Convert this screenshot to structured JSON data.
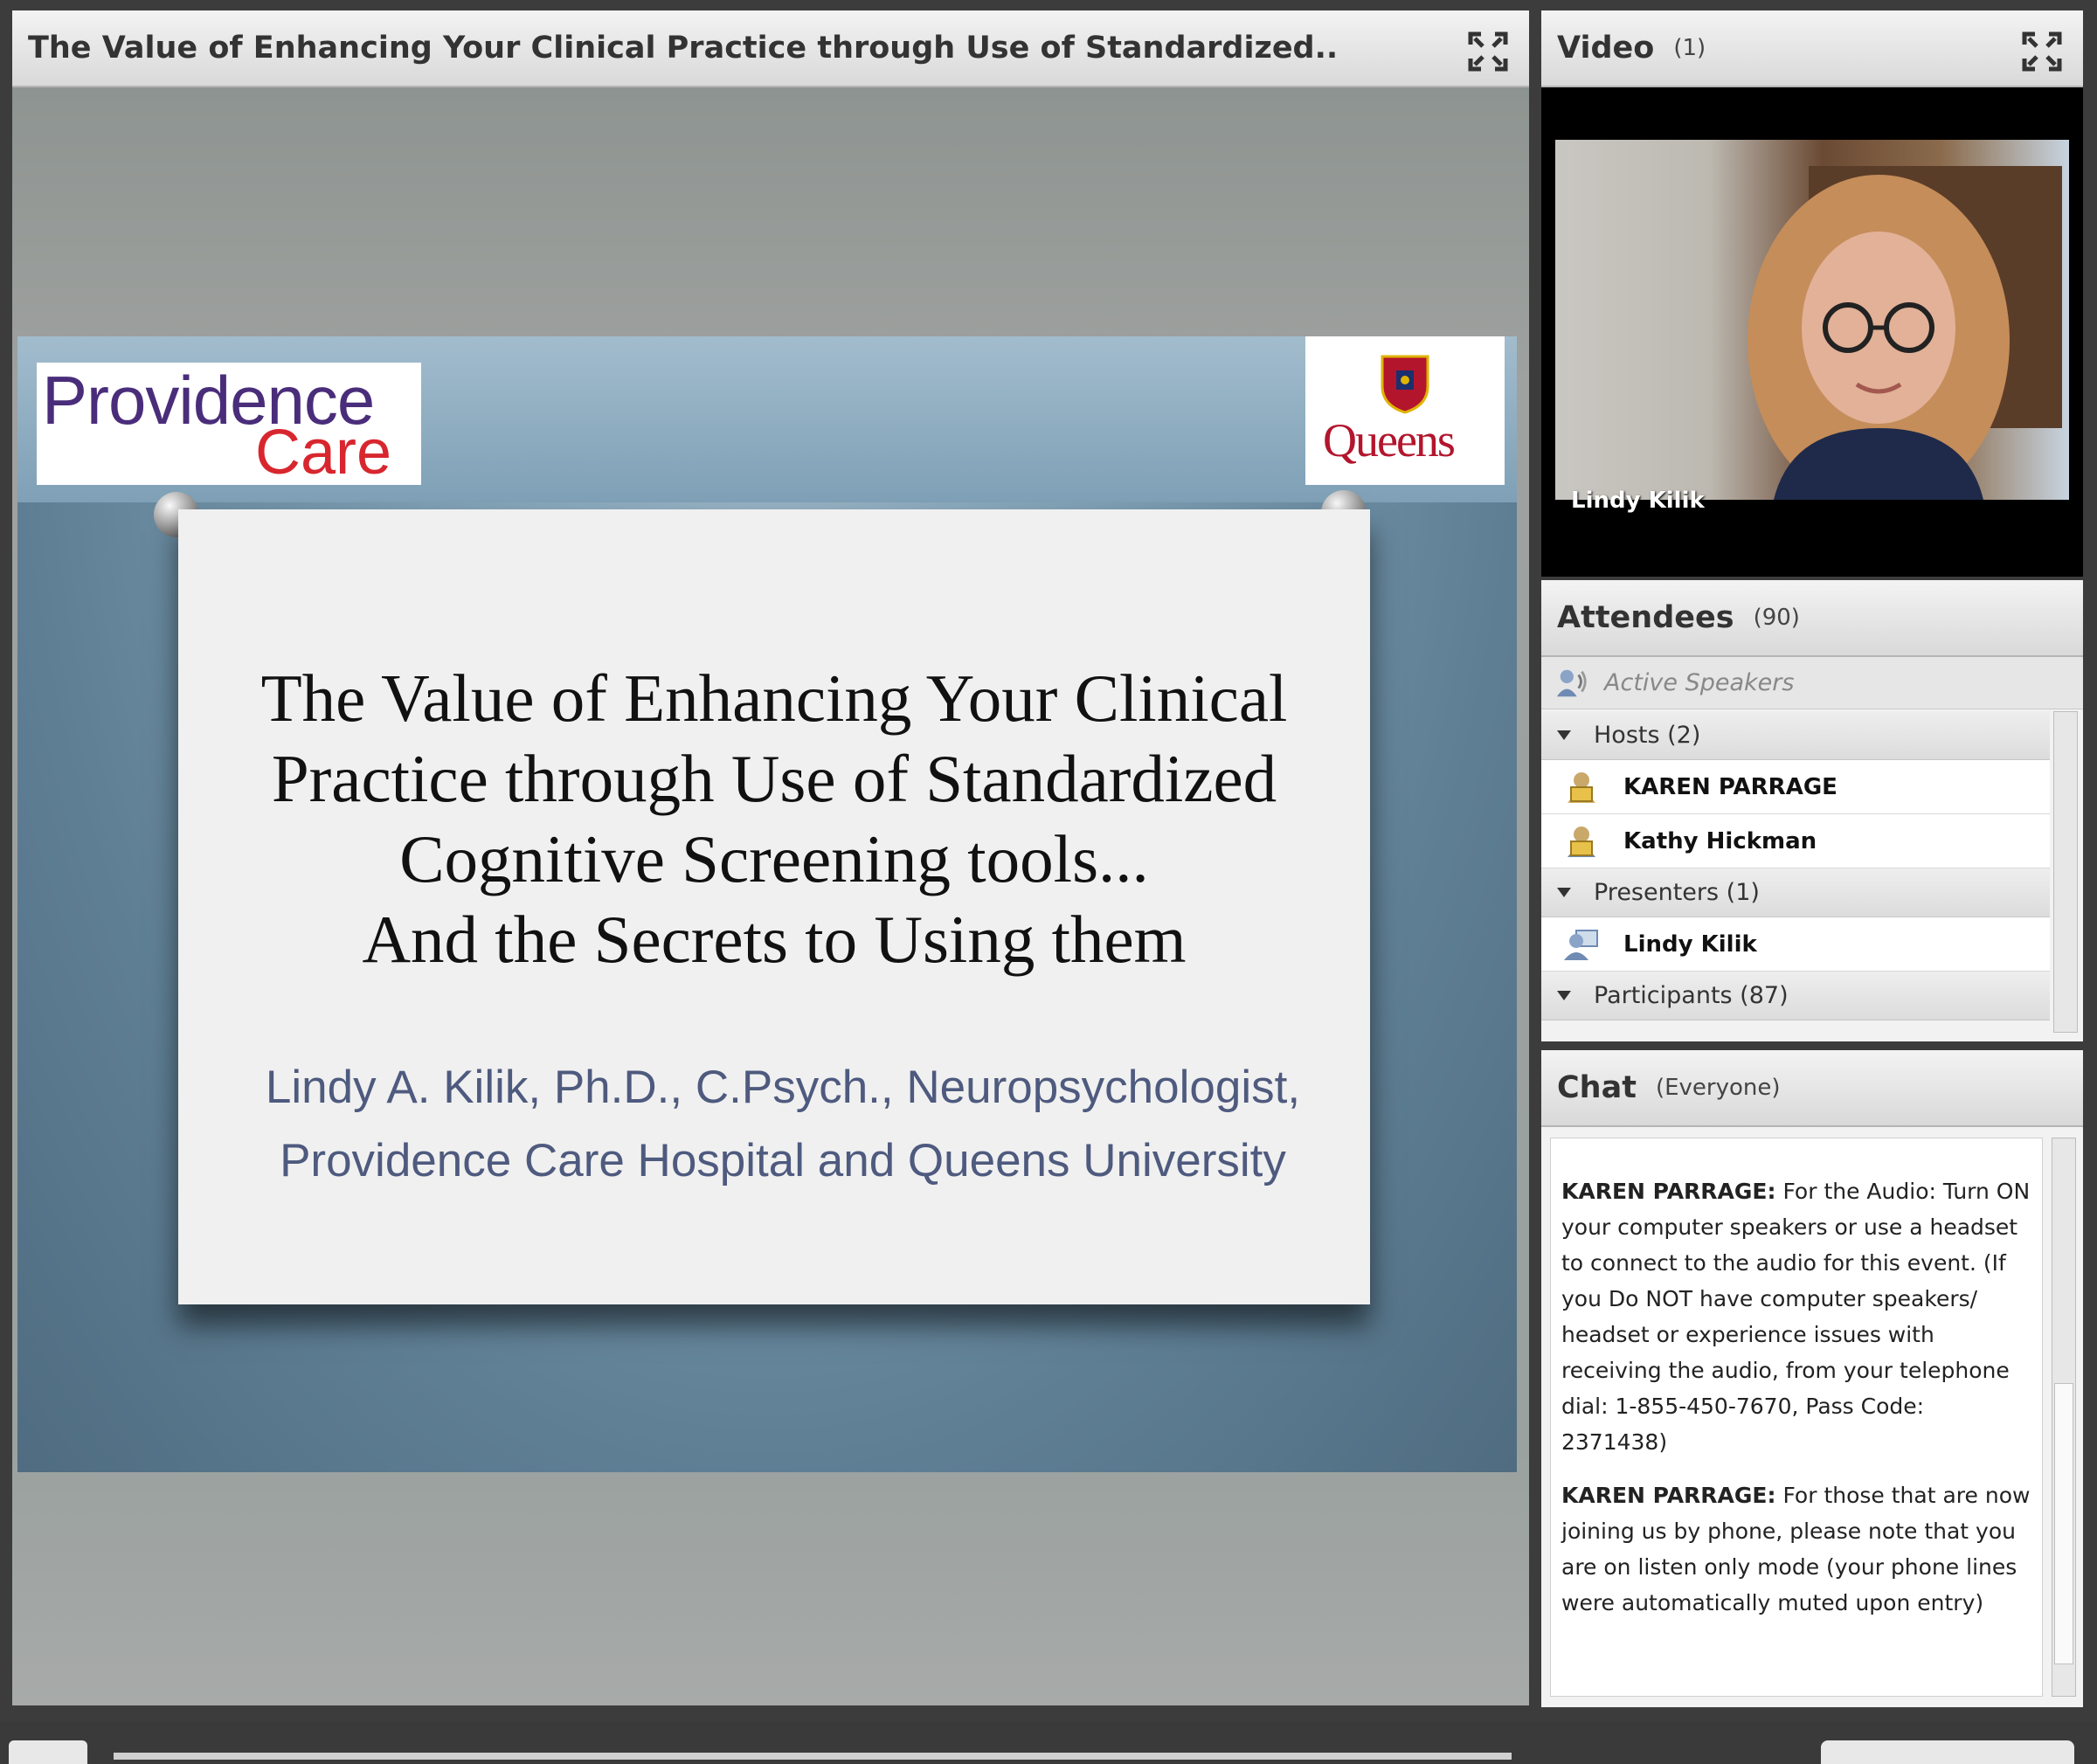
{
  "share_pod": {
    "title": "The Value of Enhancing Your Clinical Practice through Use of Standardized.."
  },
  "slide": {
    "logo_left": {
      "line1": "Providence",
      "line2": "Care"
    },
    "logo_right": "Queens",
    "title_lines": [
      "The Value of Enhancing Your Clinical",
      "Practice through Use of Standardized",
      "Cognitive Screening tools...",
      "And the Secrets to Using them"
    ],
    "author_lines": [
      "Lindy A. Kilik, Ph.D., C.Psych., Neuropsychologist,",
      "Providence Care Hospital and Queens University"
    ]
  },
  "video_pod": {
    "title": "Video",
    "count": "(1)",
    "speaker_name": "Lindy Kilik"
  },
  "attendees_pod": {
    "title": "Attendees",
    "count": "(90)",
    "active_speakers_label": "Active Speakers",
    "groups": [
      {
        "label": "Hosts (2)",
        "members": [
          "KAREN PARRAGE",
          "Kathy Hickman"
        ]
      },
      {
        "label": "Presenters (1)",
        "members": [
          "Lindy Kilik"
        ]
      },
      {
        "label": "Participants (87)",
        "members": []
      }
    ]
  },
  "chat_pod": {
    "title": "Chat",
    "scope": "(Everyone)",
    "messages": [
      {
        "sender": "KAREN PARRAGE:",
        "text": " For the Audio: Turn ON your computer speakers or use a headset to connect to the audio for this event.  (If you Do NOT have computer speakers/ headset or experience issues with receiving the audio, from your telephone dial: 1-855-450-7670, Pass Code: 2371438)"
      },
      {
        "sender": "KAREN PARRAGE:",
        "text": " For those that are now joining us by phone, please note that you are on listen only mode (your phone lines were automatically muted upon entry)"
      }
    ]
  },
  "colors": {
    "providence_purple": "#4a2d7a",
    "providence_red": "#d8262f",
    "queens_red": "#b3152d",
    "author_text": "#4e5a7e"
  },
  "icons": {
    "expand": "fullscreen-expand-icon",
    "active_speakers": "speaker-icon",
    "host": "host-lock-icon",
    "presenter": "presenter-icon",
    "group_toggle": "triangle-down-icon"
  }
}
